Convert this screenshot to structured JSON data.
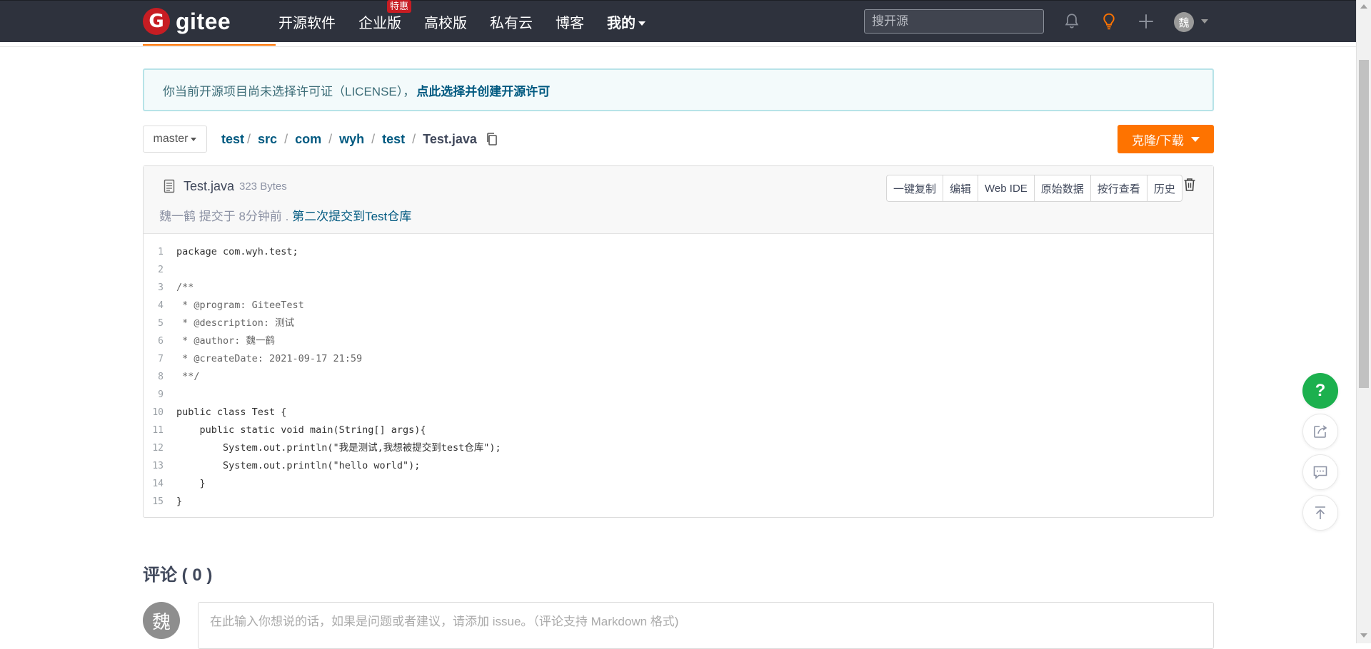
{
  "nav": {
    "logo_text": "gitee",
    "items": [
      {
        "label": "开源软件"
      },
      {
        "label": "企业版",
        "badge": "特惠"
      },
      {
        "label": "高校版"
      },
      {
        "label": "私有云"
      },
      {
        "label": "博客"
      }
    ],
    "mine_label": "我的",
    "search_placeholder": "搜开源",
    "avatar_char": "魏"
  },
  "license_alert": {
    "text": "你当前开源项目尚未选择许可证（LICENSE），",
    "link": "点此选择并创建开源许可"
  },
  "breadcrumb": {
    "branch": "master",
    "parts": [
      "test",
      "src",
      "com",
      "wyh",
      "test"
    ],
    "file": "Test.java",
    "separator": "/"
  },
  "clone_button": "克隆/下载",
  "file": {
    "name": "Test.java",
    "size": "323 Bytes",
    "commit_author_time": "魏一鹤 提交于 8分钟前 .",
    "commit_message": "第二次提交到Test仓库",
    "actions": [
      "一键复制",
      "编辑",
      "Web IDE",
      "原始数据",
      "按行查看",
      "历史"
    ]
  },
  "code_lines": [
    "package com.wyh.test;",
    "",
    "/**",
    " * @program: GiteeTest",
    " * @description: 测试",
    " * @author: 魏一鹤",
    " * @createDate: 2021-09-17 21:59",
    " **/",
    "",
    "public class Test {",
    "    public static void main(String[] args){",
    "        System.out.println(\"我是测试,我想被提交到test仓库\");",
    "        System.out.println(\"hello world\");",
    "    }",
    "}"
  ],
  "comments": {
    "title": "评论 ( 0 )",
    "avatar_char": "魏",
    "placeholder": "在此输入你想说的话，如果是问题或者建议，请添加 issue。（评论支持 Markdown 格式)"
  },
  "floating": {
    "help": "?"
  },
  "colors": {
    "nav_bg": "#2e323d",
    "accent_orange": "#fe7300",
    "brand_red": "#c71d23",
    "link_blue": "#005980",
    "help_green": "#1cb04e"
  }
}
